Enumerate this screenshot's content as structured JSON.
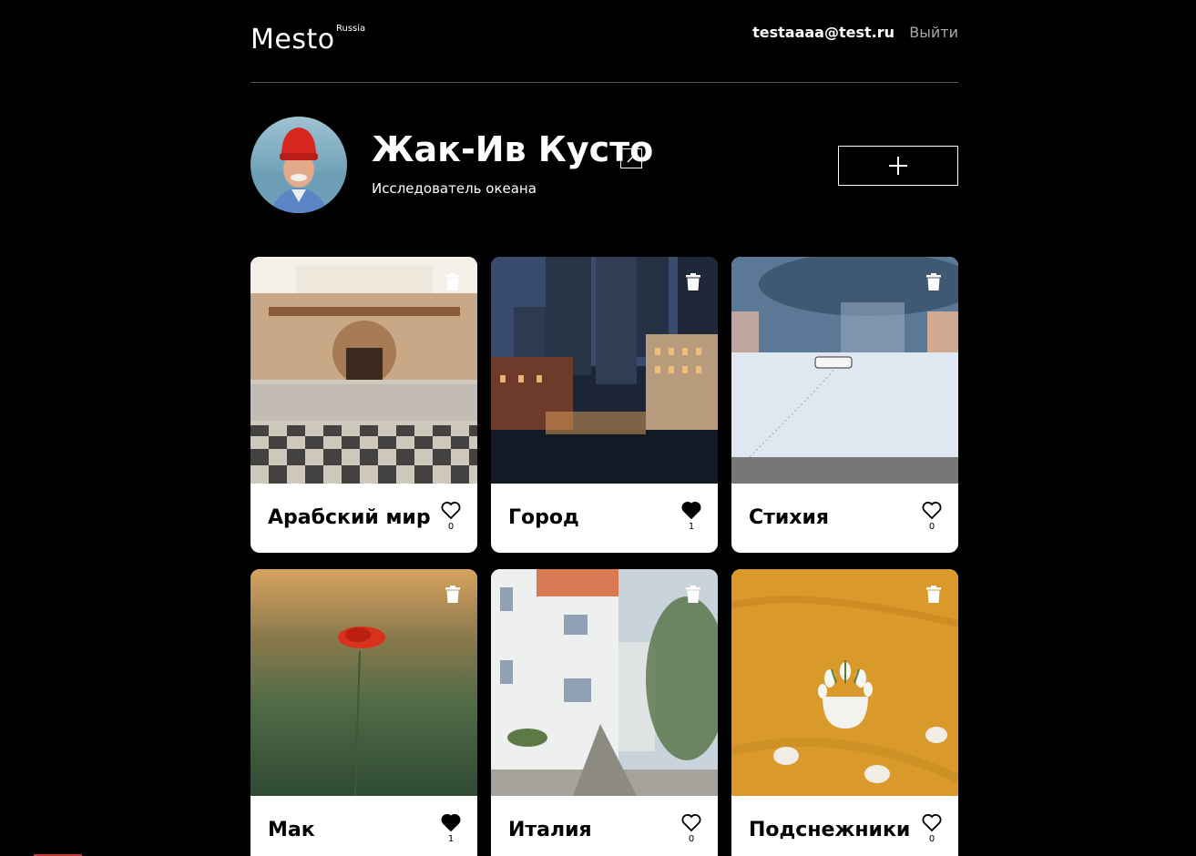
{
  "header": {
    "logo": "Mesto",
    "logo_sup": "Russia",
    "email": "testaaaa@test.ru",
    "logout": "Выйти"
  },
  "profile": {
    "name": "Жак-Ив Кусто",
    "about": "Исследователь океана"
  },
  "cards": [
    {
      "title": "Арабский мир",
      "likes": "0",
      "liked": false,
      "image": "courtyard-photo"
    },
    {
      "title": "Город",
      "likes": "1",
      "liked": true,
      "image": "city-night-photo"
    },
    {
      "title": "Стихия",
      "likes": "0",
      "liked": false,
      "image": "snow-storm-photo"
    },
    {
      "title": "Мак",
      "likes": "1",
      "liked": true,
      "image": "poppy-field-photo"
    },
    {
      "title": "Италия",
      "likes": "0",
      "liked": false,
      "image": "white-street-photo"
    },
    {
      "title": "Подснежники",
      "likes": "0",
      "liked": false,
      "image": "snowdrops-photo"
    }
  ]
}
